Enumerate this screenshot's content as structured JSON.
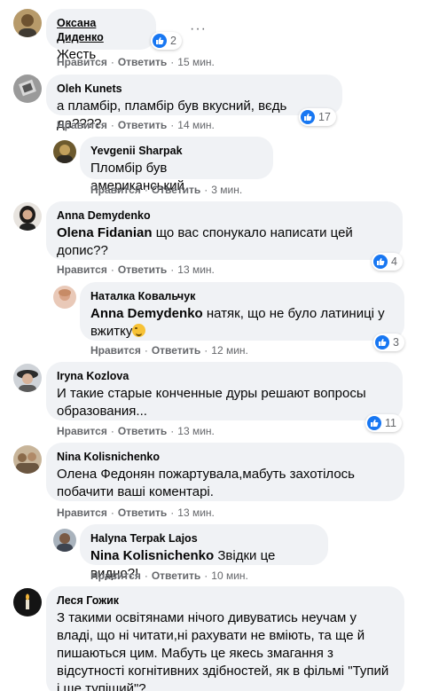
{
  "ui": {
    "like_label": "Нравится",
    "reply_label": "Ответить",
    "separator": "·",
    "more_glyph": "···"
  },
  "comments": [
    {
      "author": "Оксана Диденко",
      "text": "Жесть",
      "time": "15 мин.",
      "likes": "2"
    },
    {
      "author": "Oleh Kunets",
      "text": "а пламбір, пламбір був вкусний, вєдь да????",
      "time": "14 мин.",
      "likes": "17"
    },
    {
      "author": "Yevgenii Sharpak",
      "text": "Пломбір був американський",
      "time": "3 мин.",
      "likes": ""
    },
    {
      "author": "Anna Demydenko",
      "mention": "Olena Fidanian",
      "text": " що вас спонукало написати цей допис??",
      "time": "13 мин.",
      "likes": "4"
    },
    {
      "author": "Наталка Ковальчук",
      "mention": "Anna Demydenko",
      "text": " натяк, що не було латиниці у вжитку",
      "time": "12 мин.",
      "likes": "3"
    },
    {
      "author": "Iryna Kozlova",
      "text": "И такие старые конченные дуры решают вопросы образования...",
      "time": "13 мин.",
      "likes": "11"
    },
    {
      "author": "Nina Kolisnichenko",
      "text": "Олена Федонян пожартувала,мабуть захотілось побачити ваші коментарі.",
      "time": "13 мин.",
      "likes": ""
    },
    {
      "author": "Halyna Terpak Lajos",
      "mention": "Nina Kolisnichenko",
      "text": " Звідки це видно?!",
      "time": "10 мин.",
      "likes": ""
    },
    {
      "author": "Леся Гожик",
      "text": "З такими освітянами нічого дивуватись неучам у владі, що ні читати,ні рахувати не вміють, та ще й пишаються цим. Мабуть це якесь змагання з відсутності когнітивних здібностей, як в фільмі \"Тупий і ще тупіший\"?",
      "time": "",
      "likes": ""
    }
  ],
  "colors": {
    "bubble": "#f0f2f5",
    "meta": "#65676b",
    "like_blue": "#1877f2"
  }
}
